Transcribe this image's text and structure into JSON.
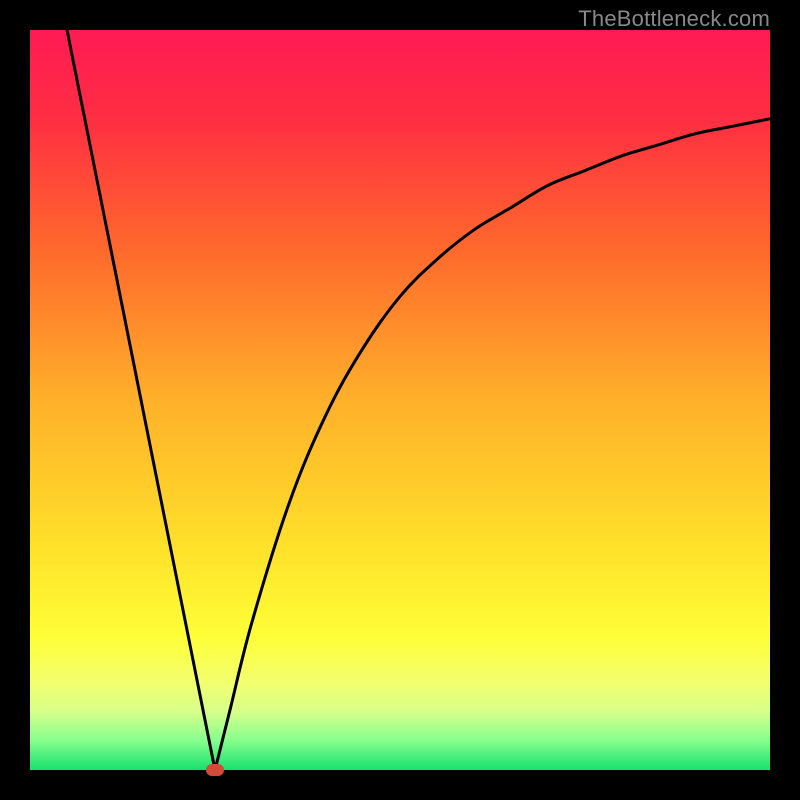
{
  "watermark": "TheBottleneck.com",
  "chart_data": {
    "type": "line",
    "title": "",
    "xlabel": "",
    "ylabel": "",
    "xlim": [
      0,
      100
    ],
    "ylim": [
      0,
      100
    ],
    "grid": false,
    "legend": false,
    "series": [
      {
        "name": "left-branch",
        "x": [
          5,
          10,
          15,
          20,
          25
        ],
        "y": [
          100,
          75,
          50,
          25,
          0
        ]
      },
      {
        "name": "right-branch",
        "x": [
          25,
          27,
          30,
          35,
          40,
          45,
          50,
          55,
          60,
          65,
          70,
          75,
          80,
          85,
          90,
          95,
          100
        ],
        "y": [
          0,
          8,
          20,
          36,
          48,
          57,
          64,
          69,
          73,
          76,
          79,
          81,
          83,
          84.5,
          86,
          87,
          88
        ]
      }
    ],
    "annotations": [
      {
        "name": "minimum-marker",
        "x": 25,
        "y": 0,
        "color": "#d24a3a"
      }
    ],
    "gradient": [
      {
        "stop": 0,
        "color": "#ff1a54"
      },
      {
        "stop": 12,
        "color": "#ff2e42"
      },
      {
        "stop": 30,
        "color": "#ff6a2c"
      },
      {
        "stop": 50,
        "color": "#ffb02a"
      },
      {
        "stop": 70,
        "color": "#ffe12a"
      },
      {
        "stop": 82,
        "color": "#feff37"
      },
      {
        "stop": 88,
        "color": "#f3ff6e"
      },
      {
        "stop": 92,
        "color": "#d9ff8a"
      },
      {
        "stop": 96,
        "color": "#86ff8d"
      },
      {
        "stop": 100,
        "color": "#18e070"
      }
    ],
    "curve_stroke": "#000000",
    "curve_width": 3
  }
}
